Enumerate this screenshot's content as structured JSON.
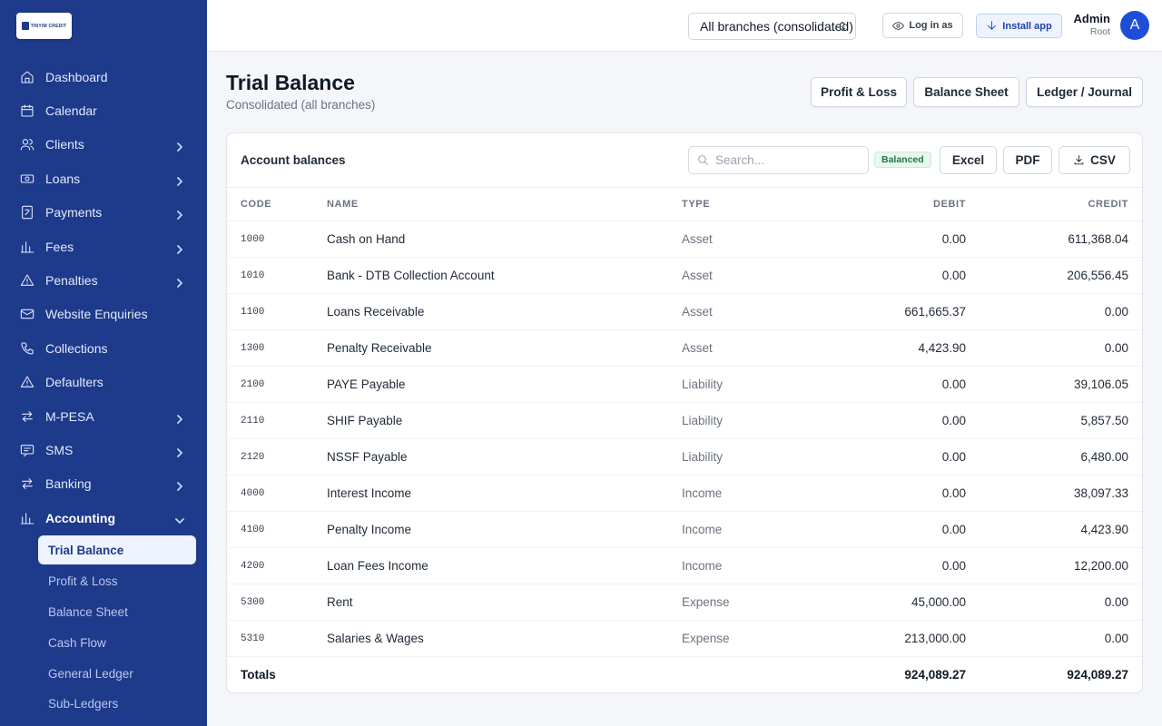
{
  "brand": {
    "logo_text": "TINYIM CREDIT"
  },
  "sidebar": {
    "items": [
      {
        "label": "Dashboard",
        "icon": "home-icon",
        "expandable": false
      },
      {
        "label": "Calendar",
        "icon": "calendar-icon",
        "expandable": false
      },
      {
        "label": "Clients",
        "icon": "users-icon",
        "expandable": true
      },
      {
        "label": "Loans",
        "icon": "banknote-icon",
        "expandable": true
      },
      {
        "label": "Payments",
        "icon": "receipt-icon",
        "expandable": true
      },
      {
        "label": "Fees",
        "icon": "bar-chart-icon",
        "expandable": true
      },
      {
        "label": "Penalties",
        "icon": "warning-icon",
        "expandable": true
      },
      {
        "label": "Website Enquiries",
        "icon": "mail-icon",
        "expandable": false
      },
      {
        "label": "Collections",
        "icon": "phone-icon",
        "expandable": false
      },
      {
        "label": "Defaulters",
        "icon": "warning-icon",
        "expandable": false
      },
      {
        "label": "M-PESA",
        "icon": "transfer-icon",
        "expandable": true
      },
      {
        "label": "SMS",
        "icon": "message-icon",
        "expandable": true
      },
      {
        "label": "Banking",
        "icon": "transfer-icon",
        "expandable": true
      },
      {
        "label": "Accounting",
        "icon": "bar-chart-icon",
        "expandable": true,
        "expanded": true
      }
    ],
    "accounting_sub": [
      {
        "label": "Trial Balance",
        "active": true
      },
      {
        "label": "Profit & Loss",
        "active": false
      },
      {
        "label": "Balance Sheet",
        "active": false
      },
      {
        "label": "Cash Flow",
        "active": false
      },
      {
        "label": "General Ledger",
        "active": false
      },
      {
        "label": "Sub-Ledgers",
        "active": false
      }
    ]
  },
  "header": {
    "branch_select": "All branches (consolidated)",
    "login_as": "Log in as",
    "install_app": "Install app",
    "user_name": "Admin",
    "user_role": "Root",
    "avatar_letter": "A"
  },
  "page": {
    "title": "Trial Balance",
    "subtitle": "Consolidated (all branches)",
    "buttons": {
      "pl": "Profit & Loss",
      "bs": "Balance Sheet",
      "lj": "Ledger / Journal"
    }
  },
  "card": {
    "title": "Account balances",
    "search_placeholder": "Search...",
    "status_badge": "Balanced",
    "excel": "Excel",
    "pdf": "PDF",
    "csv": "CSV"
  },
  "table": {
    "headers": {
      "code": "CODE",
      "name": "NAME",
      "type": "TYPE",
      "debit": "DEBIT",
      "credit": "CREDIT"
    },
    "rows": [
      {
        "code": "1000",
        "name": "Cash on Hand",
        "type": "Asset",
        "debit": "0.00",
        "credit": "611,368.04"
      },
      {
        "code": "1010",
        "name": "Bank - DTB Collection Account",
        "type": "Asset",
        "debit": "0.00",
        "credit": "206,556.45"
      },
      {
        "code": "1100",
        "name": "Loans Receivable",
        "type": "Asset",
        "debit": "661,665.37",
        "credit": "0.00"
      },
      {
        "code": "1300",
        "name": "Penalty Receivable",
        "type": "Asset",
        "debit": "4,423.90",
        "credit": "0.00"
      },
      {
        "code": "2100",
        "name": "PAYE Payable",
        "type": "Liability",
        "debit": "0.00",
        "credit": "39,106.05"
      },
      {
        "code": "2110",
        "name": "SHIF Payable",
        "type": "Liability",
        "debit": "0.00",
        "credit": "5,857.50"
      },
      {
        "code": "2120",
        "name": "NSSF Payable",
        "type": "Liability",
        "debit": "0.00",
        "credit": "6,480.00"
      },
      {
        "code": "4000",
        "name": "Interest Income",
        "type": "Income",
        "debit": "0.00",
        "credit": "38,097.33"
      },
      {
        "code": "4100",
        "name": "Penalty Income",
        "type": "Income",
        "debit": "0.00",
        "credit": "4,423.90"
      },
      {
        "code": "4200",
        "name": "Loan Fees Income",
        "type": "Income",
        "debit": "0.00",
        "credit": "12,200.00"
      },
      {
        "code": "5300",
        "name": "Rent",
        "type": "Expense",
        "debit": "45,000.00",
        "credit": "0.00"
      },
      {
        "code": "5310",
        "name": "Salaries & Wages",
        "type": "Expense",
        "debit": "213,000.00",
        "credit": "0.00"
      }
    ],
    "totals": {
      "label": "Totals",
      "debit": "924,089.27",
      "credit": "924,089.27"
    }
  },
  "colors": {
    "sidebar_bg": "#1e3a8a",
    "accent": "#1d4ed8",
    "badge_green": "#1f7a3d"
  }
}
